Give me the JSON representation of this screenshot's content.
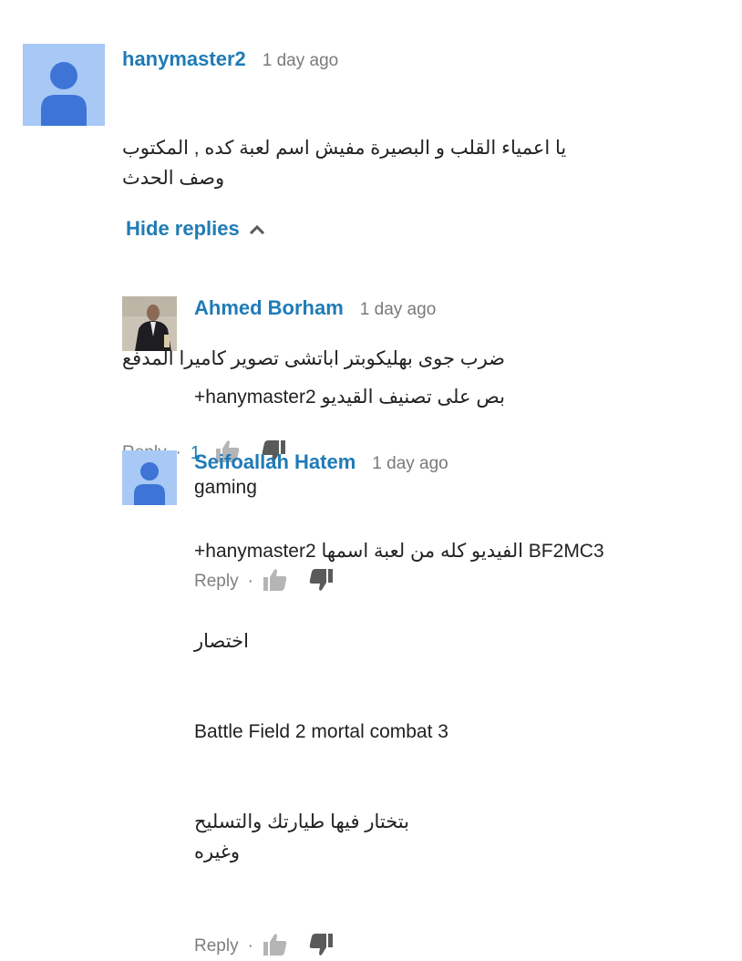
{
  "colors": {
    "author": "#1f7bb6",
    "timestamp": "#7a7a7a",
    "action_gray": "#7e7e7e",
    "avatar_bg": "#a8c8f6",
    "avatar_figure": "#3d74d6",
    "thumb_gray": "#b5b5b5"
  },
  "top_comment": {
    "author": "hanymaster2",
    "time": "1 day ago",
    "lines": [
      "يا اعمياء القلب و البصيرة مفيش اسم لعبة كده , المكتوب وصف الحدث",
      "",
      "ضرب جوى بهليكوبتر اباتشى تصوير كاميرا المدفع"
    ],
    "reply_label": "Reply",
    "separator": "·",
    "like_count": "1",
    "avatar_icon": "default-user-icon"
  },
  "hide_replies": {
    "label": "Hide replies",
    "icon": "chevron-up-icon"
  },
  "replies": [
    {
      "author": "Ahmed Borham",
      "time": "1 day ago",
      "lines": [
        "+hanymaster2 بص على تصنيف القيديو",
        "gaming"
      ],
      "reply_label": "Reply",
      "separator": "·",
      "avatar_icon": "profile-photo"
    },
    {
      "author": "Seifoallah Hatem",
      "time": "1 day ago",
      "lines": [
        "+hanymaster2 الفيديو كله من لعبة اسمها BF2MC3",
        "اختصار",
        "Battle Field 2 mortal combat 3",
        "بتختار فيها طيارتك والتسليح وغيره"
      ],
      "reply_label": "Reply",
      "separator": "·",
      "avatar_icon": "default-user-icon"
    }
  ]
}
